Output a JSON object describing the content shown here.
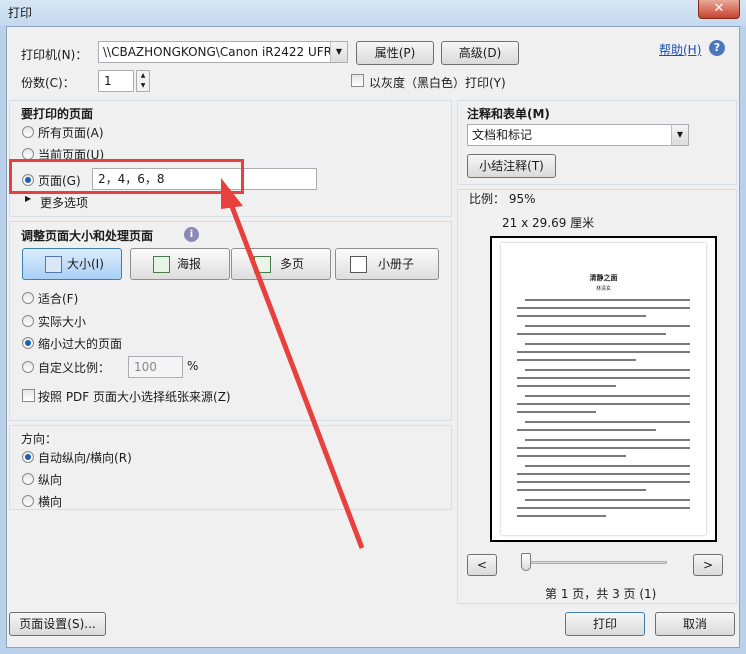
{
  "window": {
    "title": "打印",
    "close": "✕"
  },
  "printer": {
    "label": "打印机(N)：",
    "value": "\\\\CBAZHONGKONG\\Canon iR2422 UFRII LT",
    "properties_btn": "属性(P)",
    "advanced_btn": "高级(D)",
    "help_link": "帮助(H)",
    "copies_label": "份数(C)：",
    "copies_value": "1",
    "grayscale_label": "以灰度（黑白色）打印(Y)"
  },
  "pages": {
    "title": "要打印的页面",
    "all": "所有页面(A)",
    "current": "当前页面(U)",
    "range": "页面(G)",
    "range_value": "2，4，6，8",
    "more": "更多选项"
  },
  "sizing": {
    "title": "调整页面大小和处理页面",
    "buttons": [
      "大小(I)",
      "海报",
      "多页",
      "小册子"
    ],
    "fit": "适合(F)",
    "actual": "实际大小",
    "shrink": "缩小过大的页面",
    "custom": "自定义比例：",
    "custom_value": "100",
    "percent": "%",
    "paper_source": "按照 PDF 页面大小选择纸张来源(Z)"
  },
  "orientation": {
    "title": "方向：",
    "auto": "自动纵向/横向(R)",
    "portrait": "纵向",
    "landscape": "横向"
  },
  "comments": {
    "title": "注释和表单(M)",
    "value": "文档和标记",
    "summarize_btn": "小结注释(T)"
  },
  "preview": {
    "scale": "比例：  95%",
    "size": "21 x 29.69 厘米",
    "doc_title": "清静之面",
    "doc_author": "林清玄",
    "page_info": "第 1 页，共 3 页 (1)",
    "prev": "<",
    "next": ">"
  },
  "footer": {
    "page_setup": "页面设置(S)...",
    "print": "打印",
    "cancel": "取消"
  }
}
